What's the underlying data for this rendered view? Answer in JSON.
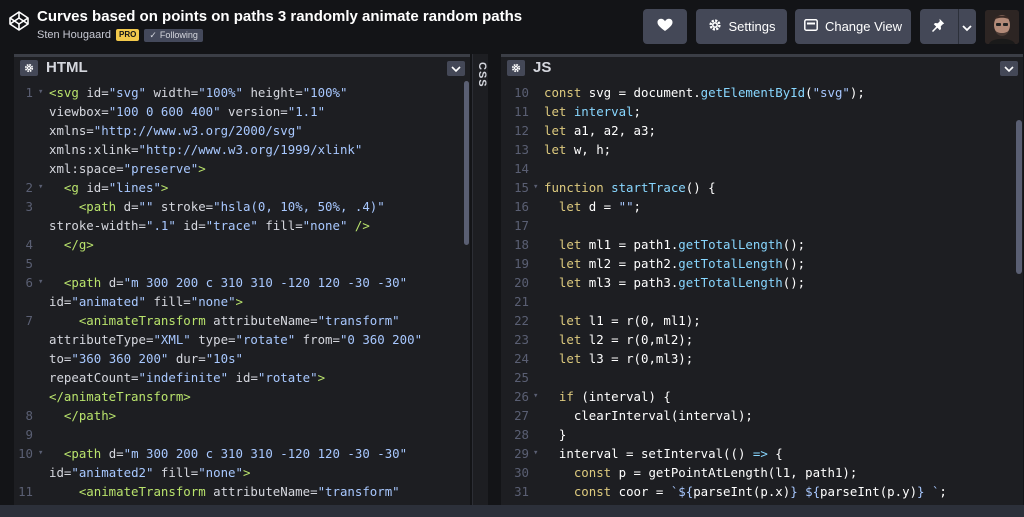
{
  "header": {
    "title": "Curves based on points on paths 3 randomly animate random paths",
    "author": "Sten Hougaard",
    "pro_badge": "PRO",
    "following_badge": "Following",
    "settings_label": "Settings",
    "change_view_label": "Change View"
  },
  "html_panel": {
    "label": "HTML"
  },
  "css_panel": {
    "label": "CSS"
  },
  "js_panel": {
    "label": "JS"
  },
  "colors": {
    "accent_pro": "#f2c94c",
    "button_bg": "#444857",
    "editor_bg": "#1d1e22",
    "tag": "#b9e36c",
    "string": "#a8c8ff",
    "keyword": "#ddca7e",
    "function": "#88d7ff"
  },
  "html_lines": [
    {
      "n": "1",
      "fold": true,
      "parts": [
        [
          "c-tag",
          "<svg "
        ],
        [
          "c-attr",
          "id="
        ],
        [
          "c-str",
          "\"svg\""
        ],
        [
          "c-attr",
          " width="
        ],
        [
          "c-str",
          "\"100%\""
        ],
        [
          "c-attr",
          " height="
        ],
        [
          "c-str",
          "\"100%\""
        ]
      ]
    },
    {
      "n": "",
      "fold": false,
      "parts": [
        [
          "c-attr",
          "viewbox="
        ],
        [
          "c-str",
          "\"100 0 600 400\""
        ],
        [
          "c-attr",
          " version="
        ],
        [
          "c-str",
          "\"1.1\""
        ]
      ]
    },
    {
      "n": "",
      "fold": false,
      "parts": [
        [
          "c-attr",
          "xmlns="
        ],
        [
          "c-str",
          "\"http://www.w3.org/2000/svg\""
        ]
      ]
    },
    {
      "n": "",
      "fold": false,
      "parts": [
        [
          "c-attr",
          "xmlns:xlink="
        ],
        [
          "c-str",
          "\"http://www.w3.org/1999/xlink\""
        ]
      ]
    },
    {
      "n": "",
      "fold": false,
      "parts": [
        [
          "c-attr",
          "xml:space="
        ],
        [
          "c-str",
          "\"preserve\""
        ],
        [
          "c-tag",
          ">"
        ]
      ]
    },
    {
      "n": "2",
      "fold": true,
      "parts": [
        [
          "c-plain",
          "  "
        ],
        [
          "c-tag",
          "<g "
        ],
        [
          "c-attr",
          "id="
        ],
        [
          "c-str",
          "\"lines\""
        ],
        [
          "c-tag",
          ">"
        ]
      ]
    },
    {
      "n": "3",
      "fold": false,
      "parts": [
        [
          "c-plain",
          "    "
        ],
        [
          "c-tag",
          "<path "
        ],
        [
          "c-attr",
          "d="
        ],
        [
          "c-str",
          "\"\""
        ],
        [
          "c-attr",
          " stroke="
        ],
        [
          "c-str",
          "\"hsla(0, 10%, 50%, .4)\""
        ]
      ]
    },
    {
      "n": "",
      "fold": false,
      "parts": [
        [
          "c-attr",
          "stroke-width="
        ],
        [
          "c-str",
          "\".1\""
        ],
        [
          "c-attr",
          " id="
        ],
        [
          "c-str",
          "\"trace\""
        ],
        [
          "c-attr",
          " fill="
        ],
        [
          "c-str",
          "\"none\""
        ],
        [
          "c-tag",
          " />"
        ]
      ]
    },
    {
      "n": "4",
      "fold": false,
      "parts": [
        [
          "c-plain",
          "  "
        ],
        [
          "c-tag",
          "</g>"
        ]
      ]
    },
    {
      "n": "5",
      "fold": false,
      "parts": []
    },
    {
      "n": "6",
      "fold": true,
      "parts": [
        [
          "c-plain",
          "  "
        ],
        [
          "c-tag",
          "<path "
        ],
        [
          "c-attr",
          "d="
        ],
        [
          "c-str",
          "\"m 300 200 c 310 310 -120 120 -30 -30\""
        ]
      ]
    },
    {
      "n": "",
      "fold": false,
      "parts": [
        [
          "c-attr",
          "id="
        ],
        [
          "c-str",
          "\"animated\""
        ],
        [
          "c-attr",
          " fill="
        ],
        [
          "c-str",
          "\"none\""
        ],
        [
          "c-tag",
          ">"
        ]
      ]
    },
    {
      "n": "7",
      "fold": false,
      "parts": [
        [
          "c-plain",
          "    "
        ],
        [
          "c-tag",
          "<animateTransform "
        ],
        [
          "c-attr",
          "attributeName="
        ],
        [
          "c-str",
          "\"transform\""
        ]
      ]
    },
    {
      "n": "",
      "fold": false,
      "parts": [
        [
          "c-attr",
          "attributeType="
        ],
        [
          "c-str",
          "\"XML\""
        ],
        [
          "c-attr",
          " type="
        ],
        [
          "c-str",
          "\"rotate\""
        ],
        [
          "c-attr",
          " from="
        ],
        [
          "c-str",
          "\"0 360 200\""
        ]
      ]
    },
    {
      "n": "",
      "fold": false,
      "parts": [
        [
          "c-attr",
          "to="
        ],
        [
          "c-str",
          "\"360 360 200\""
        ],
        [
          "c-attr",
          " dur="
        ],
        [
          "c-str",
          "\"10s\""
        ]
      ]
    },
    {
      "n": "",
      "fold": false,
      "parts": [
        [
          "c-attr",
          "repeatCount="
        ],
        [
          "c-str",
          "\"indefinite\""
        ],
        [
          "c-attr",
          " id="
        ],
        [
          "c-str",
          "\"rotate\""
        ],
        [
          "c-tag",
          ">"
        ]
      ]
    },
    {
      "n": "",
      "fold": false,
      "parts": [
        [
          "c-tag",
          "</animateTransform>"
        ]
      ]
    },
    {
      "n": "8",
      "fold": false,
      "parts": [
        [
          "c-plain",
          "  "
        ],
        [
          "c-tag",
          "</path>"
        ]
      ]
    },
    {
      "n": "9",
      "fold": false,
      "parts": []
    },
    {
      "n": "10",
      "fold": true,
      "parts": [
        [
          "c-plain",
          "  "
        ],
        [
          "c-tag",
          "<path "
        ],
        [
          "c-attr",
          "d="
        ],
        [
          "c-str",
          "\"m 300 200 c 310 310 -120 120 -30 -30\""
        ]
      ]
    },
    {
      "n": "",
      "fold": false,
      "parts": [
        [
          "c-attr",
          "id="
        ],
        [
          "c-str",
          "\"animated2\""
        ],
        [
          "c-attr",
          " fill="
        ],
        [
          "c-str",
          "\"none\""
        ],
        [
          "c-tag",
          ">"
        ]
      ]
    },
    {
      "n": "11",
      "fold": false,
      "parts": [
        [
          "c-plain",
          "    "
        ],
        [
          "c-tag",
          "<animateTransform "
        ],
        [
          "c-attr",
          "attributeName="
        ],
        [
          "c-str",
          "\"transform\""
        ]
      ]
    }
  ],
  "js_lines": [
    {
      "n": "10",
      "fold": false,
      "parts": [
        [
          "c-kw",
          "const "
        ],
        [
          "c-plain",
          "svg = document."
        ],
        [
          "c-fn",
          "getElementById"
        ],
        [
          "c-plain",
          "("
        ],
        [
          "c-str",
          "\"svg\""
        ],
        [
          "c-plain",
          ");"
        ]
      ]
    },
    {
      "n": "11",
      "fold": false,
      "parts": [
        [
          "c-kw",
          "let "
        ],
        [
          "c-fn",
          "interval"
        ],
        [
          "c-plain",
          ";"
        ]
      ]
    },
    {
      "n": "12",
      "fold": false,
      "parts": [
        [
          "c-kw",
          "let "
        ],
        [
          "c-plain",
          "a1, a2, a3;"
        ]
      ]
    },
    {
      "n": "13",
      "fold": false,
      "parts": [
        [
          "c-kw",
          "let "
        ],
        [
          "c-plain",
          "w, h;"
        ]
      ]
    },
    {
      "n": "14",
      "fold": false,
      "parts": []
    },
    {
      "n": "15",
      "fold": true,
      "parts": [
        [
          "c-kw",
          "function "
        ],
        [
          "c-fn",
          "startTrace"
        ],
        [
          "c-plain",
          "() {"
        ]
      ]
    },
    {
      "n": "16",
      "fold": false,
      "parts": [
        [
          "c-plain",
          "  "
        ],
        [
          "c-kw",
          "let "
        ],
        [
          "c-plain",
          "d = "
        ],
        [
          "c-str",
          "\"\""
        ],
        [
          "c-plain",
          ";"
        ]
      ]
    },
    {
      "n": "17",
      "fold": false,
      "parts": []
    },
    {
      "n": "18",
      "fold": false,
      "parts": [
        [
          "c-plain",
          "  "
        ],
        [
          "c-kw",
          "let "
        ],
        [
          "c-plain",
          "ml1 = path1."
        ],
        [
          "c-fn",
          "getTotalLength"
        ],
        [
          "c-plain",
          "();"
        ]
      ]
    },
    {
      "n": "19",
      "fold": false,
      "parts": [
        [
          "c-plain",
          "  "
        ],
        [
          "c-kw",
          "let "
        ],
        [
          "c-plain",
          "ml2 = path2."
        ],
        [
          "c-fn",
          "getTotalLength"
        ],
        [
          "c-plain",
          "();"
        ]
      ]
    },
    {
      "n": "20",
      "fold": false,
      "parts": [
        [
          "c-plain",
          "  "
        ],
        [
          "c-kw",
          "let "
        ],
        [
          "c-plain",
          "ml3 = path3."
        ],
        [
          "c-fn",
          "getTotalLength"
        ],
        [
          "c-plain",
          "();"
        ]
      ]
    },
    {
      "n": "21",
      "fold": false,
      "parts": []
    },
    {
      "n": "22",
      "fold": false,
      "parts": [
        [
          "c-plain",
          "  "
        ],
        [
          "c-kw",
          "let "
        ],
        [
          "c-plain",
          "l1 = r(0, ml1);"
        ]
      ]
    },
    {
      "n": "23",
      "fold": false,
      "parts": [
        [
          "c-plain",
          "  "
        ],
        [
          "c-kw",
          "let "
        ],
        [
          "c-plain",
          "l2 = r(0,ml2);"
        ]
      ]
    },
    {
      "n": "24",
      "fold": false,
      "parts": [
        [
          "c-plain",
          "  "
        ],
        [
          "c-kw",
          "let "
        ],
        [
          "c-plain",
          "l3 = r(0,ml3);"
        ]
      ]
    },
    {
      "n": "25",
      "fold": false,
      "parts": []
    },
    {
      "n": "26",
      "fold": true,
      "parts": [
        [
          "c-plain",
          "  "
        ],
        [
          "c-kw",
          "if "
        ],
        [
          "c-plain",
          "(interval) {"
        ]
      ]
    },
    {
      "n": "27",
      "fold": false,
      "parts": [
        [
          "c-plain",
          "    clearInterval(interval);"
        ]
      ]
    },
    {
      "n": "28",
      "fold": false,
      "parts": [
        [
          "c-plain",
          "  }"
        ]
      ]
    },
    {
      "n": "29",
      "fold": true,
      "parts": [
        [
          "c-plain",
          "  interval = setInterval(() "
        ],
        [
          "c-fn",
          "=>"
        ],
        [
          "c-plain",
          " {"
        ]
      ]
    },
    {
      "n": "30",
      "fold": false,
      "parts": [
        [
          "c-plain",
          "    "
        ],
        [
          "c-kw",
          "const "
        ],
        [
          "c-plain",
          "p = getPointAtLength(l1, path1);"
        ]
      ]
    },
    {
      "n": "31",
      "fold": false,
      "parts": [
        [
          "c-plain",
          "    "
        ],
        [
          "c-kw",
          "const "
        ],
        [
          "c-plain",
          "coor = "
        ],
        [
          "c-str",
          "`${"
        ],
        [
          "c-plain",
          "parseInt(p.x)"
        ],
        [
          "c-str",
          "} ${"
        ],
        [
          "c-plain",
          "parseInt(p.y)"
        ],
        [
          "c-str",
          "} `"
        ],
        [
          "c-plain",
          ";"
        ]
      ]
    }
  ]
}
